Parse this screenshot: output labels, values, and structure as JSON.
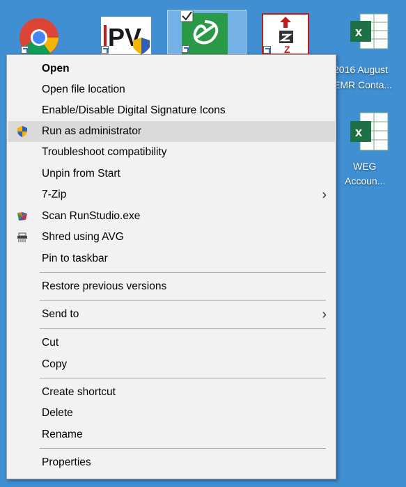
{
  "desktop": {
    "icons": [
      {
        "name": "chrome"
      },
      {
        "name": "ipv"
      },
      {
        "name": "runstudio"
      },
      {
        "name": "pdf-tool"
      },
      {
        "name": "excel-emr",
        "label_line1": "2016 August",
        "label_line2": "EMR Conta..."
      },
      {
        "name": "excel-weg",
        "label_line1": "WEG",
        "label_line2": "Accoun..."
      }
    ],
    "colors": {
      "background": "#3f8fd2",
      "excel_green": "#1e7145"
    }
  },
  "menu": {
    "items": [
      {
        "label": "Open",
        "bold": true
      },
      {
        "label": "Open file location"
      },
      {
        "label": "Enable/Disable Digital Signature Icons"
      },
      {
        "label": "Run as administrator",
        "icon": "shield-icon",
        "highlighted": true
      },
      {
        "label": "Troubleshoot compatibility"
      },
      {
        "label": "Unpin from Start"
      },
      {
        "label": "7-Zip",
        "submenu": true
      },
      {
        "label": "Scan RunStudio.exe",
        "icon": "avast-icon"
      },
      {
        "label": "Shred using AVG",
        "icon": "shredder-icon"
      },
      {
        "label": "Pin to taskbar"
      },
      {
        "label": "Restore previous versions"
      },
      {
        "label": "Send to",
        "submenu": true
      },
      {
        "label": "Cut"
      },
      {
        "label": "Copy"
      },
      {
        "label": "Create shortcut"
      },
      {
        "label": "Delete"
      },
      {
        "label": "Rename"
      },
      {
        "label": "Properties"
      }
    ],
    "submenu_arrow": "›"
  }
}
